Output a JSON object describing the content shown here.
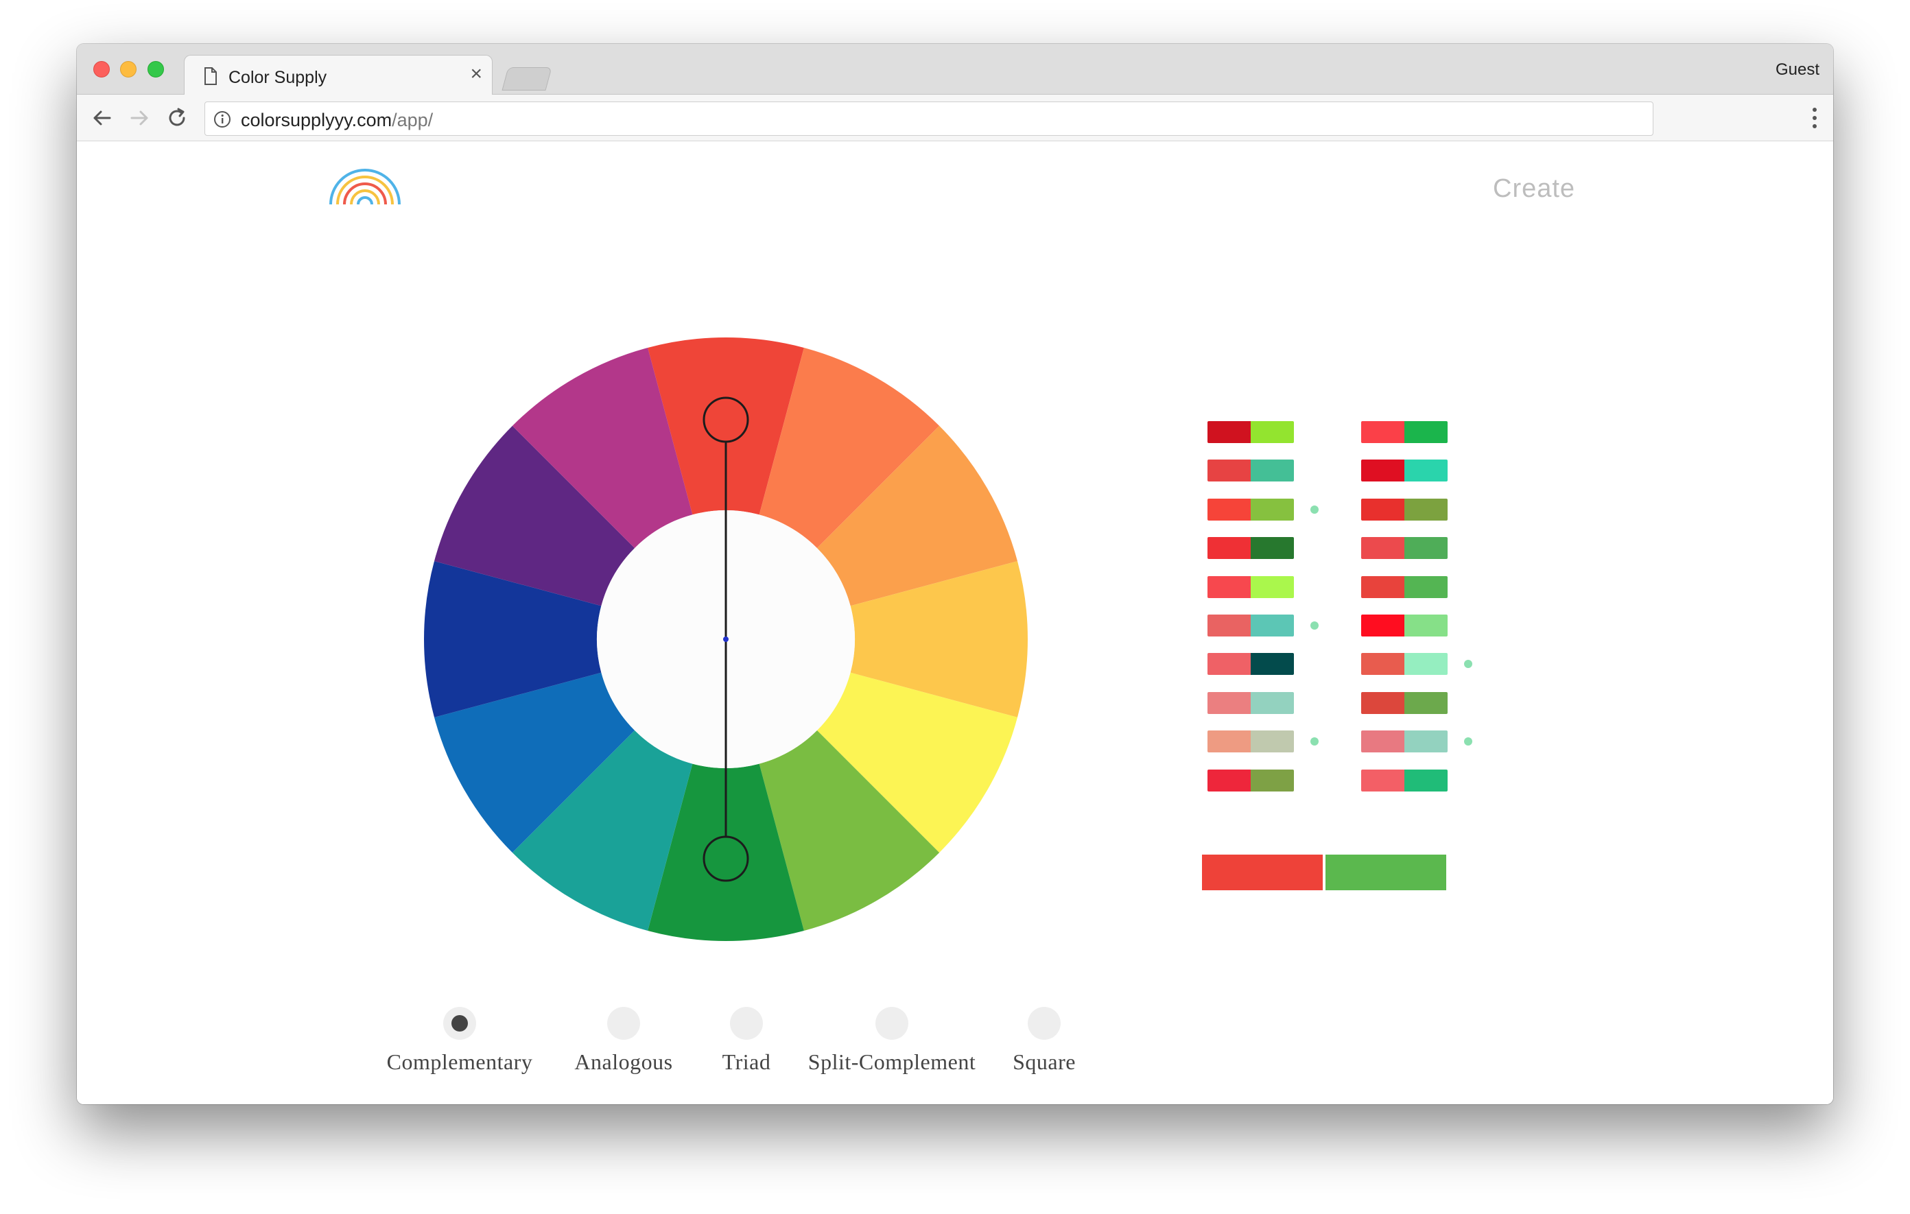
{
  "browser": {
    "tab_title": "Color Supply",
    "tab_close": "×",
    "profile": "Guest",
    "url_host": "colorsupplyyy.com",
    "url_path": "/app/"
  },
  "app": {
    "create_label": "Create"
  },
  "wheel": {
    "segments": [
      "#ef4538",
      "#fb7c4c",
      "#fba04c",
      "#fdc74c",
      "#fcf454",
      "#7abd42",
      "#16963e",
      "#1aa298",
      "#0f6db9",
      "#13369a",
      "#5f2783",
      "#b3378a"
    ],
    "hole_color": "#fcfcfc",
    "handle_a_color": "#ef4538",
    "handle_b_color": "#16963e"
  },
  "palettes": [
    {
      "a": "#d0121f",
      "b": "#93e42f"
    },
    {
      "a": "#fb4048",
      "b": "#1bb54c"
    },
    {
      "a": "#e74343",
      "b": "#44bf96"
    },
    {
      "a": "#df0f22",
      "b": "#2ad4ac"
    },
    {
      "a": "#f64439",
      "b": "#86c13f"
    },
    {
      "a": "#e8302d",
      "b": "#7ca23f"
    },
    {
      "a": "#ef3035",
      "b": "#27782e"
    },
    {
      "a": "#ec4a4d",
      "b": "#4fad58"
    },
    {
      "a": "#f7484e",
      "b": "#aaf74c"
    },
    {
      "a": "#e8433c",
      "b": "#54b553"
    },
    {
      "a": "#e96362",
      "b": "#5cc6b5"
    },
    {
      "a": "#ff0d20",
      "b": "#86e088"
    },
    {
      "a": "#ef6166",
      "b": "#034b4c"
    },
    {
      "a": "#e85c4e",
      "b": "#95eec0"
    },
    {
      "a": "#eb7f80",
      "b": "#93d2bf"
    },
    {
      "a": "#dc473c",
      "b": "#6ca94c"
    },
    {
      "a": "#ee9b82",
      "b": "#c0c9ae"
    },
    {
      "a": "#e87981",
      "b": "#93d2bf"
    },
    {
      "a": "#ee263b",
      "b": "#7ea145"
    },
    {
      "a": "#f35f66",
      "b": "#20bc78"
    }
  ],
  "palette_dots": [
    {
      "row": 2,
      "col": 0
    },
    {
      "row": 5,
      "col": 0
    },
    {
      "row": 8,
      "col": 0
    },
    {
      "row": 6,
      "col": 1
    },
    {
      "row": 8,
      "col": 1
    }
  ],
  "selected": {
    "a": "#ee4239",
    "b": "#5bb84e"
  },
  "modes": {
    "items": [
      "Complementary",
      "Analogous",
      "Triad",
      "Split-Complement",
      "Square"
    ],
    "selected_index": 0
  }
}
